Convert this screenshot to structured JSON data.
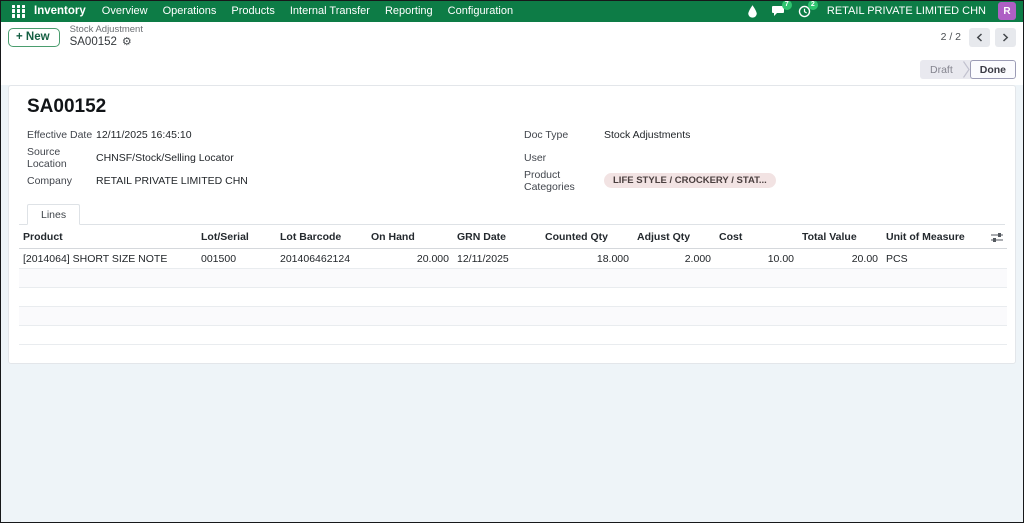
{
  "colors": {
    "navbar": "#0d7c46",
    "badge": "#2fc46f",
    "avatar": "#ae5fc4",
    "success": "#2e9a5d",
    "tag_bg": "#f2e3e3",
    "content_bg": "#eef4f8"
  },
  "nav": {
    "app": "Inventory",
    "items": [
      "Overview",
      "Operations",
      "Products",
      "Internal Transfer",
      "Reporting",
      "Configuration"
    ],
    "badges": {
      "messages": "7",
      "activities": "2"
    },
    "company": "RETAIL PRIVATE LIMITED CHN",
    "avatar_initial": "R"
  },
  "control_panel": {
    "new_button_icon": "+",
    "new_button": "New",
    "breadcrumb_parent": "Stock Adjustment",
    "breadcrumb_current": "SA00152",
    "gear_icon": "⚙",
    "pager": "2 / 2"
  },
  "statusbar": {
    "states": [
      "Draft",
      "Done"
    ],
    "active": "Done"
  },
  "form": {
    "title": "SA00152",
    "fields_left": [
      {
        "label": "Effective Date",
        "value": "12/11/2025 16:45:10"
      },
      {
        "label": "Source Location",
        "value": "CHNSF/Stock/Selling Locator"
      },
      {
        "label": "Company",
        "value": "RETAIL PRIVATE LIMITED CHN"
      }
    ],
    "fields_right": [
      {
        "label": "Doc Type",
        "value": "Stock Adjustments"
      },
      {
        "label": "User",
        "value": ""
      },
      {
        "label": "Product Categories",
        "value": "LIFE STYLE / CROCKERY / STAT..."
      }
    ],
    "tab": "Lines"
  },
  "lines_table": {
    "columns": [
      "Product",
      "Lot/Serial",
      "Lot Barcode",
      "On Hand",
      "GRN Date",
      "Counted Qty",
      "Adjust Qty",
      "Cost",
      "Total Value",
      "Unit of Measure"
    ],
    "rows": [
      {
        "product": "[2014064] SHORT SIZE NOTE",
        "lot_serial": "001500",
        "lot_barcode": "201406462124",
        "on_hand": "20.000",
        "grn_date": "12/11/2025",
        "counted_qty": "18.000",
        "adjust_qty": "2.000",
        "cost": "10.00",
        "total_value": "20.00",
        "uom": "PCS"
      }
    ]
  }
}
